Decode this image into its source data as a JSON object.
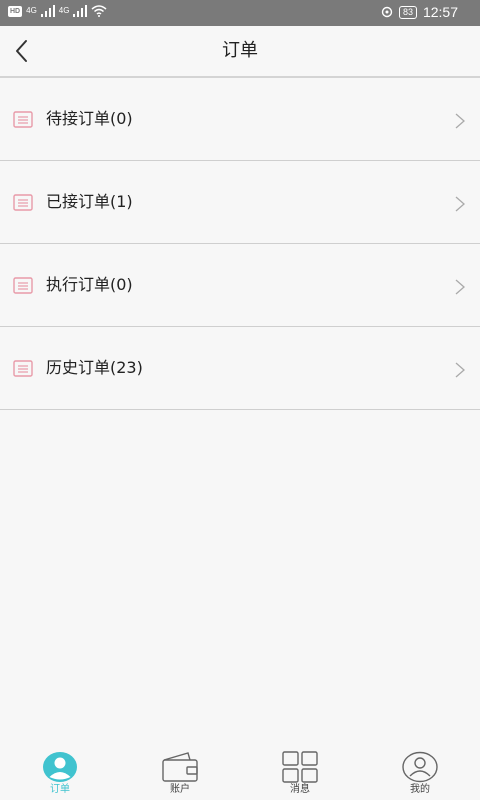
{
  "status_bar": {
    "hd": "HD",
    "network_1": "4G",
    "network_2": "4G",
    "battery": "83",
    "time": "12:57"
  },
  "header": {
    "title": "订单",
    "back_icon": "chevron-left-icon"
  },
  "order_list": [
    {
      "label": "待接订单(0)",
      "icon": "clipboard-icon"
    },
    {
      "label": "已接订单(1)",
      "icon": "clipboard-icon"
    },
    {
      "label": "执行订单(0)",
      "icon": "clipboard-icon"
    },
    {
      "label": "历史订单(23)",
      "icon": "clipboard-icon"
    }
  ],
  "tab_bar": {
    "tabs": [
      {
        "label": "订单",
        "icon": "user-circle-icon",
        "active": true
      },
      {
        "label": "账户",
        "icon": "wallet-icon",
        "active": false
      },
      {
        "label": "消息",
        "icon": "grid-icon",
        "active": false
      },
      {
        "label": "我的",
        "icon": "profile-icon",
        "active": false
      }
    ]
  },
  "colors": {
    "accent": "#40c3cf",
    "row_icon": "#e89aa8",
    "divider": "#cfcfcf",
    "status_bar": "#7a7a7a",
    "background": "#f7f7f7"
  }
}
